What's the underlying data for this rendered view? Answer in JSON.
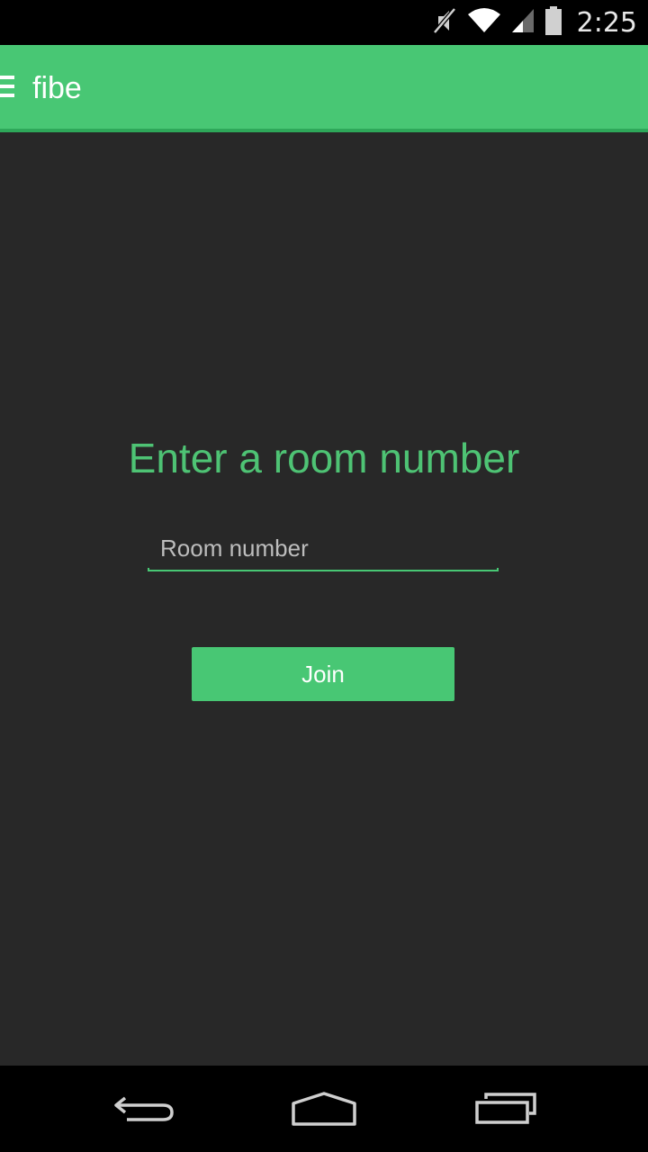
{
  "status_bar": {
    "time": "2:25",
    "icons": [
      "mute-icon",
      "wifi-icon",
      "signal-icon",
      "battery-icon"
    ]
  },
  "app_bar": {
    "title": "fibe",
    "menu_icon": "menu-icon"
  },
  "main": {
    "heading": "Enter a room number",
    "room_input": {
      "placeholder": "Room number",
      "value": ""
    },
    "join_button": "Join"
  },
  "nav_bar": {
    "icons": [
      "back-icon",
      "home-icon",
      "recents-icon"
    ]
  },
  "colors": {
    "accent": "#48c774",
    "background": "#282828",
    "status_bar": "#000000"
  }
}
